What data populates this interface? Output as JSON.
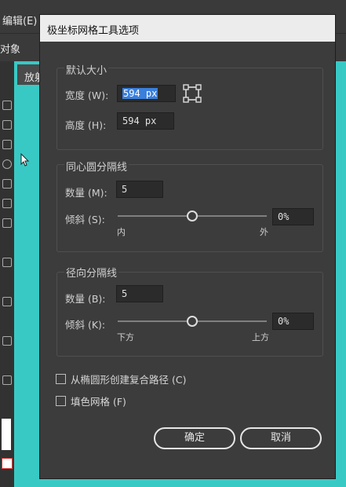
{
  "app": {
    "menu_edit": "编辑(E)",
    "object_label": "对象",
    "tab_label": "放射"
  },
  "dialog": {
    "title": "极坐标网格工具选项",
    "default_size": {
      "title": "默认大小",
      "width_label": "宽度 (W):",
      "width_value": "594 px",
      "height_label": "高度 (H):",
      "height_value": "594 px"
    },
    "concentric": {
      "title": "同心圆分隔线",
      "count_label": "数量 (M):",
      "count_value": "5",
      "skew_label": "倾斜 (S):",
      "skew_value": "0%",
      "skew_fraction": 0.5,
      "left_cap": "内",
      "right_cap": "外"
    },
    "radial": {
      "title": "径向分隔线",
      "count_label": "数量 (B):",
      "count_value": "5",
      "skew_label": "倾斜 (K):",
      "skew_value": "0%",
      "skew_fraction": 0.5,
      "left_cap": "下方",
      "right_cap": "上方"
    },
    "options": {
      "compound_path_label": "从椭圆形创建复合路径 (C)",
      "compound_path_checked": false,
      "fill_grid_label": "填色网格 (F)",
      "fill_grid_checked": false
    },
    "buttons": {
      "ok": "确定",
      "cancel": "取消"
    }
  }
}
